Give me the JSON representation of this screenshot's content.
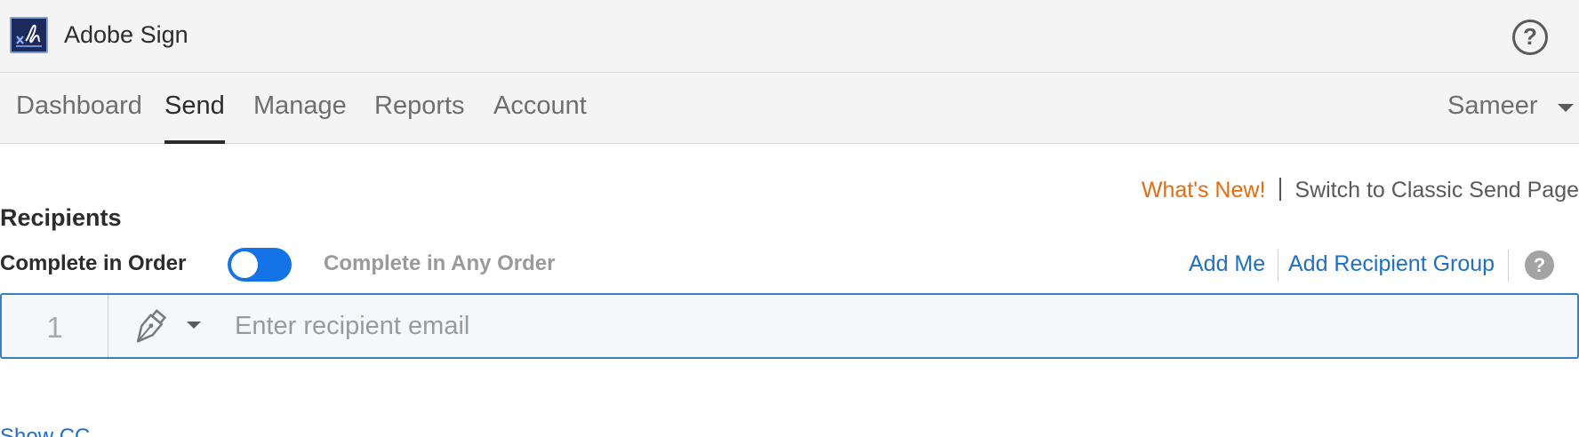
{
  "app": {
    "title": "Adobe Sign",
    "logo_icon": "adobe-sign-logo",
    "help_icon": "question-circle-icon",
    "help_label": "?"
  },
  "nav": {
    "tabs": [
      {
        "label": "Dashboard",
        "active": false
      },
      {
        "label": "Send",
        "active": true
      },
      {
        "label": "Manage",
        "active": false
      },
      {
        "label": "Reports",
        "active": false
      },
      {
        "label": "Account",
        "active": false
      }
    ],
    "user": "Sameer"
  },
  "links": {
    "whats_new": "What's New!",
    "separator": "|",
    "classic": "Switch to Classic Send Page"
  },
  "recipients": {
    "title": "Recipients",
    "order_label": "Complete in Order",
    "any_order_label": "Complete in Any Order",
    "toggle_state": "on",
    "add_me": "Add Me",
    "add_group": "Add Recipient Group",
    "help_label": "?",
    "rows": [
      {
        "number": "1",
        "role_icon": "pen-nib-icon",
        "email_placeholder": "Enter recipient email",
        "email_value": ""
      }
    ],
    "show_cc": "Show CC"
  },
  "colors": {
    "accent_blue": "#1473e6",
    "link_blue": "#1f6fc2",
    "whats_new_orange": "#e36d0f",
    "header_bg": "#f4f4f4"
  }
}
